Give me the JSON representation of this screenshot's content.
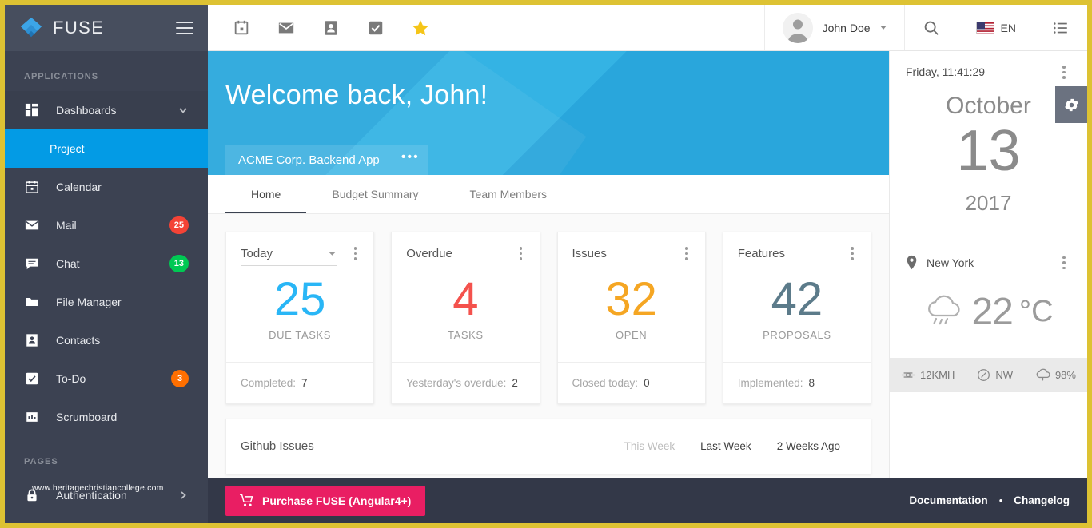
{
  "theme": {
    "border": "#ddc233",
    "sidebar_bg": "#3c4252",
    "sidebar_header_bg": "#474e5e",
    "accent_blue": "#039be5",
    "hero_blue": "#2aa8dd",
    "footer_bg": "#333848",
    "buy_pink": "#e91e63"
  },
  "sidebar": {
    "logo_text": "FUSE",
    "hamburger_icon": "hamburger-icon",
    "sections": [
      {
        "label": "APPLICATIONS",
        "items": [
          {
            "label": "Dashboards",
            "icon": "dashboard-icon",
            "expandable": true,
            "chevron": "chevron-down-icon"
          },
          {
            "label": "Project",
            "sub": true,
            "active": true
          },
          {
            "label": "Calendar",
            "icon": "calendar-icon"
          },
          {
            "label": "Mail",
            "icon": "mail-icon",
            "badge": "25",
            "badge_color": "#f44336"
          },
          {
            "label": "Chat",
            "icon": "chat-icon",
            "badge": "13",
            "badge_color": "#00c853"
          },
          {
            "label": "File Manager",
            "icon": "folder-icon"
          },
          {
            "label": "Contacts",
            "icon": "contacts-icon"
          },
          {
            "label": "To-Do",
            "icon": "check-box-icon",
            "badge": "3",
            "badge_color": "#ff6f00"
          },
          {
            "label": "Scrumboard",
            "icon": "scrumboard-icon"
          }
        ]
      },
      {
        "label": "PAGES",
        "items": [
          {
            "label": "Authentication",
            "icon": "lock-icon",
            "expandable": true,
            "chevron": "chevron-right-icon"
          }
        ]
      }
    ],
    "watermark": "www.heritagechristiancollege.com"
  },
  "toolbar": {
    "quick_icons": [
      {
        "name": "calendar-icon"
      },
      {
        "name": "mail-icon"
      },
      {
        "name": "contacts-icon"
      },
      {
        "name": "check-box-icon"
      },
      {
        "name": "star-icon"
      }
    ],
    "user_name": "John Doe",
    "user_avatar": "avatar",
    "search_icon": "search-icon",
    "language": "EN",
    "flag_icon": "us-flag-icon",
    "quick_panel_icon": "list-icon"
  },
  "hero": {
    "greeting": "Welcome back, John!",
    "project_name": "ACME Corp. Backend App",
    "project_more": "•••"
  },
  "tabs": [
    {
      "label": "Home",
      "active": true
    },
    {
      "label": "Budget Summary",
      "active": false
    },
    {
      "label": "Team Members",
      "active": false
    }
  ],
  "widgets": [
    {
      "title": "Today",
      "is_select": true,
      "value": "25",
      "value_color": "#29b6f6",
      "value_label": "DUE TASKS",
      "footer_label": "Completed:",
      "footer_value": "7",
      "menu_icon": "kebab-menu-icon"
    },
    {
      "title": "Overdue",
      "is_select": false,
      "value": "4",
      "value_color": "#f4524d",
      "value_label": "TASKS",
      "footer_label": "Yesterday's overdue:",
      "footer_value": "2",
      "menu_icon": "kebab-menu-icon"
    },
    {
      "title": "Issues",
      "is_select": false,
      "value": "32",
      "value_color": "#f5a623",
      "value_label": "OPEN",
      "footer_label": "Closed today:",
      "footer_value": "0",
      "menu_icon": "kebab-menu-icon"
    },
    {
      "title": "Features",
      "is_select": false,
      "value": "42",
      "value_color": "#5c7b8a",
      "value_label": "PROPOSALS",
      "footer_label": "Implemented:",
      "footer_value": "8",
      "menu_icon": "kebab-menu-icon"
    }
  ],
  "github": {
    "title": "Github Issues",
    "ranges": [
      {
        "label": "This Week",
        "selected": false
      },
      {
        "label": "Last Week",
        "selected": true
      },
      {
        "label": "2 Weeks Ago",
        "selected": true
      }
    ]
  },
  "right_panel": {
    "clock_label": "Friday, 11:41:29",
    "month": "October",
    "day": "13",
    "year": "2017",
    "menu_icon": "kebab-menu-icon",
    "gear_icon": "gear-icon",
    "weather": {
      "location": "New York",
      "location_icon": "map-pin-icon",
      "condition_icon": "rain-cloud-icon",
      "temperature": "22",
      "unit": "°C",
      "wind_speed": "12KMH",
      "wind_icon": "wind-icon",
      "wind_direction": "NW",
      "direction_icon": "compass-icon",
      "humidity": "98%",
      "humidity_icon": "cloud-icon"
    }
  },
  "footer": {
    "buy_label": "Purchase FUSE (Angular4+)",
    "cart_icon": "cart-icon",
    "documentation": "Documentation",
    "separator": "•",
    "changelog": "Changelog"
  }
}
